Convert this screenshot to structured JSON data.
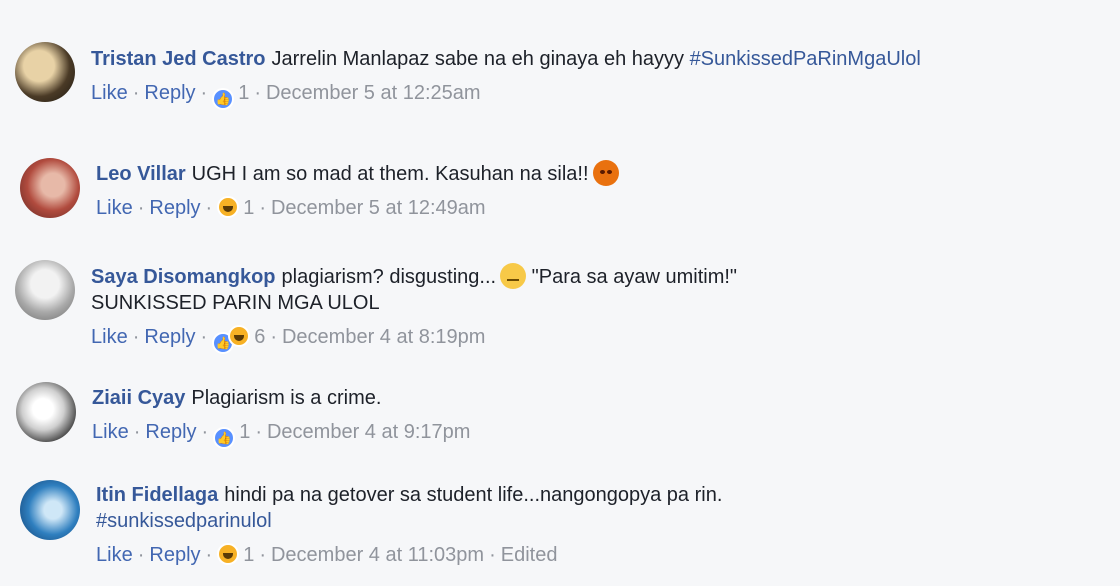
{
  "comments": [
    {
      "author": "Tristan Jed Castro",
      "text": "Jarrelin Manlapaz sabe na eh ginaya eh hayyy",
      "hashtag": "#SunkissedPaRinMgaUlol",
      "like": "Like",
      "reply": "Reply",
      "reaction_count": "1",
      "time": "December 5 at 12:25am",
      "reactions": [
        "like-icon"
      ]
    },
    {
      "author": "Leo Villar",
      "text": "UGH I am so mad at them. Kasuhan na sila!!",
      "emoji": "angry-emoji",
      "like": "Like",
      "reply": "Reply",
      "reaction_count": "1",
      "time": "December 5 at 12:49am",
      "reactions": [
        "haha-icon"
      ]
    },
    {
      "author": "Saya Disomangkop",
      "text": "plagiarism? disgusting...",
      "text_after": "\"Para sa ayaw umitim!\"",
      "line2": "SUNKISSED PARIN MGA ULOL",
      "emoji": "concerned-emoji",
      "like": "Like",
      "reply": "Reply",
      "reaction_count": "6",
      "time": "December 4 at 8:19pm",
      "reactions": [
        "like-icon",
        "haha-icon"
      ]
    },
    {
      "author": "Ziaii Cyay",
      "text": "Plagiarism is a crime.",
      "like": "Like",
      "reply": "Reply",
      "reaction_count": "1",
      "time": "December 4 at 9:17pm",
      "reactions": [
        "like-icon"
      ]
    },
    {
      "author": "Itin Fidellaga",
      "text": "hindi pa na getover sa student life...nangongopya pa rin.",
      "line2_hashtag": "#sunkissedparinulol",
      "like": "Like",
      "reply": "Reply",
      "reaction_count": "1",
      "time": "December 4 at 11:03pm",
      "edited": "Edited",
      "reactions": [
        "haha-icon"
      ]
    }
  ],
  "colors": {
    "author": "#365899",
    "link": "#4267b2",
    "meta": "#90949c",
    "background": "#f6f7f9"
  }
}
